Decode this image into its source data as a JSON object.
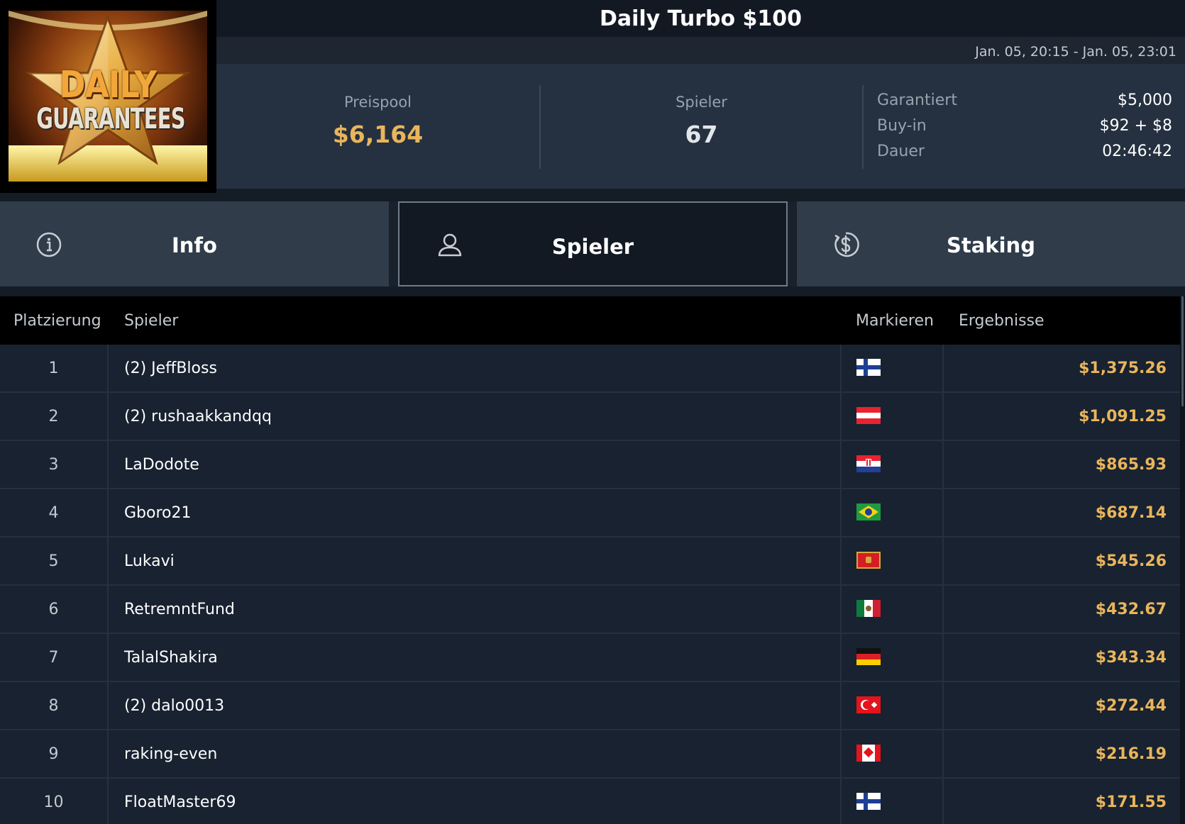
{
  "header": {
    "title": "Daily Turbo $100",
    "date_range": "Jan. 05, 20:15 - Jan. 05, 23:01"
  },
  "logo": {
    "line1": "DAILY",
    "line2": "GUARANTEES"
  },
  "stats": {
    "prize_pool": {
      "label": "Preispool",
      "value": "$6,164"
    },
    "players": {
      "label": "Spieler",
      "value": "67"
    }
  },
  "details": [
    {
      "label": "Garantiert",
      "value": "$5,000"
    },
    {
      "label": "Buy-in",
      "value": "$92 + $8"
    },
    {
      "label": "Dauer",
      "value": "02:46:42"
    }
  ],
  "tabs": [
    {
      "label": "Info",
      "icon": "info-icon",
      "active": false
    },
    {
      "label": "Spieler",
      "icon": "user-icon",
      "active": true
    },
    {
      "label": "Staking",
      "icon": "dollar-coin-icon",
      "active": false
    }
  ],
  "table": {
    "columns": [
      "Platzierung",
      "Spieler",
      "Markieren",
      "Ergebnisse"
    ],
    "rows": [
      {
        "rank": "1",
        "player": "(2) JeffBloss",
        "flag": "finland-flag",
        "result": "$1,375.26"
      },
      {
        "rank": "2",
        "player": "(2) rushaakkandqq",
        "flag": "austria-flag",
        "result": "$1,091.25"
      },
      {
        "rank": "3",
        "player": "LaDodote",
        "flag": "croatia-flag",
        "result": "$865.93"
      },
      {
        "rank": "4",
        "player": "Gboro21",
        "flag": "brazil-flag",
        "result": "$687.14"
      },
      {
        "rank": "5",
        "player": "Lukavi",
        "flag": "montenegro-flag",
        "result": "$545.26"
      },
      {
        "rank": "6",
        "player": "RetremntFund",
        "flag": "mexico-flag",
        "result": "$432.67"
      },
      {
        "rank": "7",
        "player": "TalalShakira",
        "flag": "germany-flag",
        "result": "$343.34"
      },
      {
        "rank": "8",
        "player": "(2) dalo0013",
        "flag": "turkey-flag",
        "result": "$272.44"
      },
      {
        "rank": "9",
        "player": "raking-even",
        "flag": "canada-flag",
        "result": "$216.19"
      },
      {
        "rank": "10",
        "player": "FloatMaster69",
        "flag": "finland-flag",
        "result": "$171.55"
      }
    ]
  },
  "colors": {
    "accent_gold": "#e9b55c",
    "background": "#141c26",
    "panel": "#253140",
    "active_tab": "#121923"
  }
}
